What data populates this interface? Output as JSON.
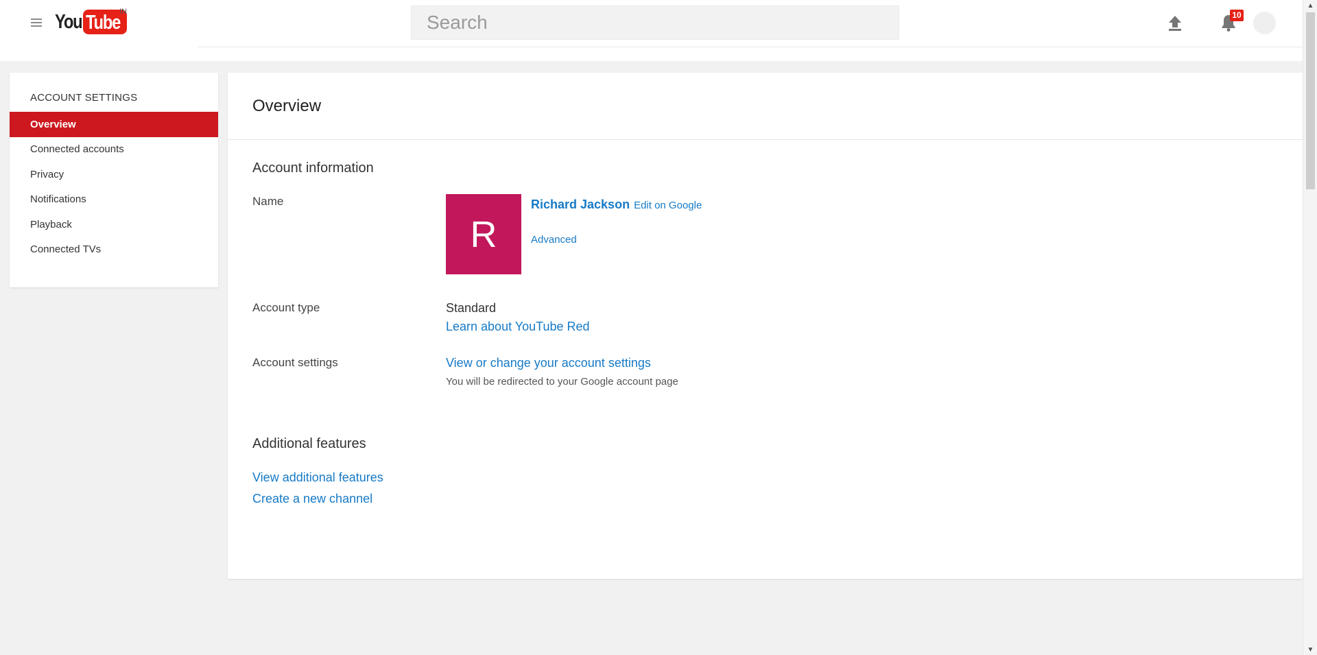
{
  "masthead": {
    "logo_you": "You",
    "logo_tube": "Tube",
    "logo_country": "IN",
    "search_placeholder": "Search",
    "notification_count": "10",
    "icons": {
      "guide": "hamburger-menu-icon",
      "upload": "upload-arrow-icon",
      "notifications": "bell-icon",
      "account": "avatar-circle"
    }
  },
  "sidebar": {
    "heading": "ACCOUNT SETTINGS",
    "items": [
      {
        "label": "Overview",
        "active": true
      },
      {
        "label": "Connected accounts",
        "active": false
      },
      {
        "label": "Privacy",
        "active": false
      },
      {
        "label": "Notifications",
        "active": false
      },
      {
        "label": "Playback",
        "active": false
      },
      {
        "label": "Connected TVs",
        "active": false
      }
    ]
  },
  "main": {
    "title": "Overview",
    "account_information": {
      "heading": "Account information",
      "name_label": "Name",
      "avatar_letter": "R",
      "name": "Richard Jackson",
      "edit_link": "Edit on Google",
      "advanced_link": "Advanced",
      "account_type_label": "Account type",
      "account_type_value": "Standard",
      "learn_link": "Learn about YouTube Red",
      "account_settings_label": "Account settings",
      "account_settings_link": "View or change your account settings",
      "account_settings_hint": "You will be redirected to your Google account page"
    },
    "additional_features": {
      "heading": "Additional features",
      "view_link": "View additional features",
      "create_link": "Create a new channel"
    }
  },
  "colors": {
    "brand_red": "#e62117",
    "nav_active": "#cc181e",
    "link_blue": "#167ac6",
    "avatar_bg": "#c2185b"
  }
}
